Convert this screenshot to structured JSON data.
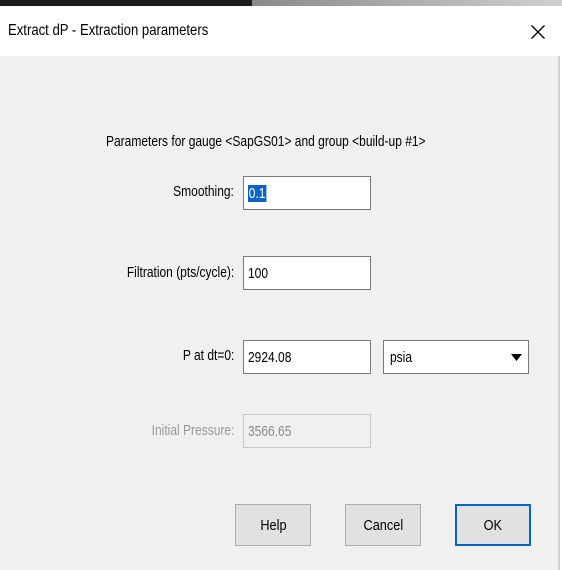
{
  "window": {
    "title": "Extract dP - Extraction parameters",
    "close_glyph": "X"
  },
  "form": {
    "header": "Parameters for gauge <SapGS01> and group <build-up #1>",
    "smoothing": {
      "label": "Smoothing:",
      "value": "0.1"
    },
    "filtration": {
      "label": "Filtration (pts/cycle):",
      "value": "100"
    },
    "p_at_dt0": {
      "label": "P at dt=0:",
      "value": "2924.08",
      "unit": "psia"
    },
    "initial_pressure": {
      "label": "Initial Pressure:",
      "value": "3566.65",
      "enabled": false
    }
  },
  "buttons": {
    "help": "Help",
    "cancel": "Cancel",
    "ok": "OK"
  },
  "icons": {
    "close": "close-icon",
    "dropdown": "chevron-down-icon"
  },
  "colors": {
    "dialog_background": "#f0f0f0",
    "selection": "#0a64c8",
    "disabled_text": "#9a9a9a",
    "default_button_border": "#0a64c8"
  }
}
